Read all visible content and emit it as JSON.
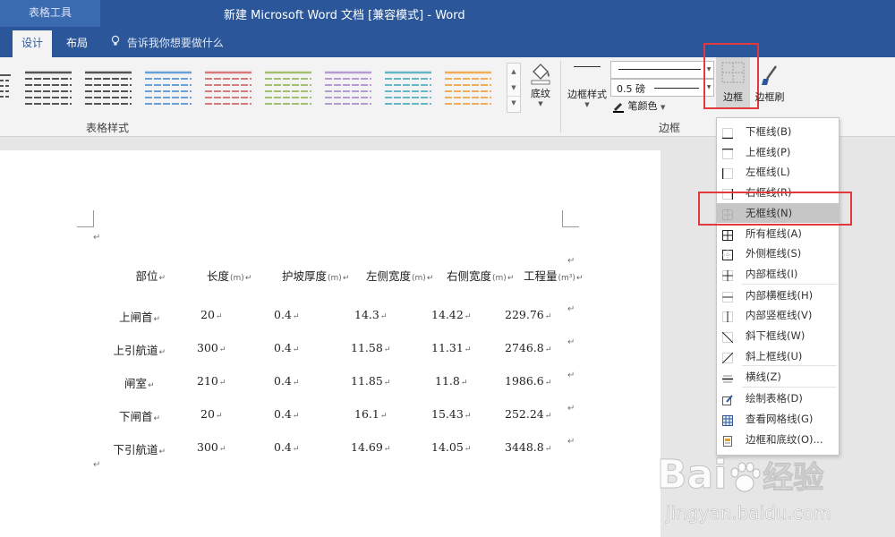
{
  "window": {
    "context_tab": "表格工具",
    "title": "新建 Microsoft Word 文档 [兼容模式]  -  Word"
  },
  "ribbon_tabs": [
    {
      "label": "设计",
      "active": true
    },
    {
      "label": "布局",
      "active": false
    }
  ],
  "tell_me": "告诉我你想要做什么",
  "ribbon": {
    "table_styles_label": "表格样式",
    "shading_label": "底纹",
    "border_styles_label": "边框样式",
    "pen_weight": "0.5 磅",
    "pen_color_label": "笔颜色",
    "borders_button_label": "边框",
    "border_painter_label": "边框刷",
    "borders_group_label": "边框",
    "style_colors": [
      "#555555",
      "#555555",
      "#6aa0d8",
      "#d67b7b",
      "#a3c070",
      "#b59ad4",
      "#66b8c8",
      "#f0ad5a",
      "#444444"
    ]
  },
  "table": {
    "headers": [
      {
        "text": "部位",
        "unit": ""
      },
      {
        "text": "长度",
        "unit": "(m)"
      },
      {
        "text": "护坡厚度",
        "unit": "(m)"
      },
      {
        "text": "左侧宽度",
        "unit": "(m)"
      },
      {
        "text": "右侧宽度",
        "unit": "(m)"
      },
      {
        "text": "工程量",
        "unit": "(m³)"
      }
    ],
    "rows": [
      [
        "上闸首",
        "20",
        "0.4",
        "14.3",
        "14.42",
        "229.76"
      ],
      [
        "上引航道",
        "300",
        "0.4",
        "11.58",
        "11.31",
        "2746.8"
      ],
      [
        "闸室",
        "210",
        "0.4",
        "11.85",
        "11.8",
        "1986.6"
      ],
      [
        "下闸首",
        "20",
        "0.4",
        "16.1",
        "15.43",
        "252.24"
      ],
      [
        "下引航道",
        "300",
        "0.4",
        "14.69",
        "14.05",
        "3448.8"
      ]
    ]
  },
  "border_menu": {
    "items": [
      {
        "label": "下框线(B)",
        "icon": "bottom-border-icon"
      },
      {
        "label": "上框线(P)",
        "icon": "top-border-icon"
      },
      {
        "label": "左框线(L)",
        "icon": "left-border-icon"
      },
      {
        "label": "右框线(R)",
        "icon": "right-border-icon"
      },
      {
        "label": "无框线(N)",
        "icon": "no-border-icon",
        "highlighted": true
      },
      {
        "label": "所有框线(A)",
        "icon": "all-borders-icon"
      },
      {
        "label": "外侧框线(S)",
        "icon": "outside-borders-icon"
      },
      {
        "label": "内部框线(I)",
        "icon": "inside-borders-icon"
      },
      {
        "label": "内部横框线(H)",
        "icon": "inside-horizontal-border-icon"
      },
      {
        "label": "内部竖框线(V)",
        "icon": "inside-vertical-border-icon"
      },
      {
        "label": "斜下框线(W)",
        "icon": "diagonal-down-border-icon"
      },
      {
        "label": "斜上框线(U)",
        "icon": "diagonal-up-border-icon"
      },
      {
        "label": "横线(Z)",
        "icon": "horizontal-line-icon"
      },
      {
        "label": "绘制表格(D)",
        "icon": "draw-table-icon"
      },
      {
        "label": "查看网格线(G)",
        "icon": "view-gridlines-icon"
      },
      {
        "label": "边框和底纹(O)...",
        "icon": "borders-and-shading-icon"
      }
    ]
  },
  "watermark": {
    "brand": "Bai",
    "brand_cn": "经验",
    "url": "jingyan.baidu.com"
  }
}
